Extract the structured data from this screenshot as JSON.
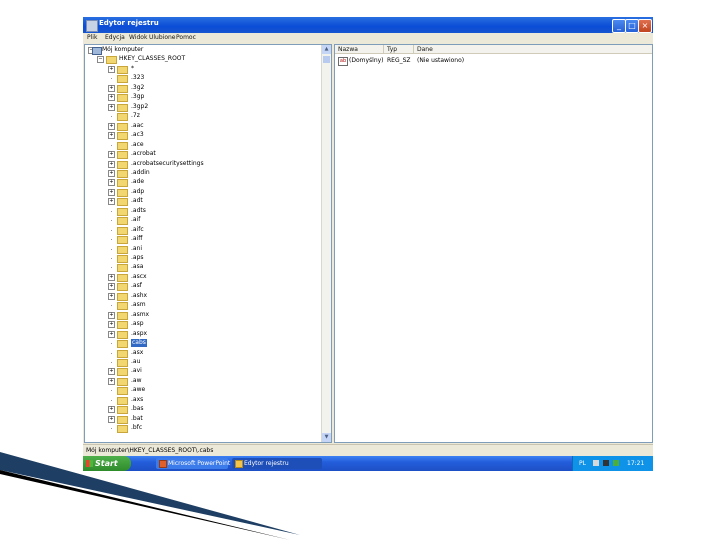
{
  "window": {
    "title": "Edytor rejestru"
  },
  "menu": [
    "Plik",
    "Edycja",
    "Widok",
    "Ulubione",
    "Pomoc"
  ],
  "tree": {
    "root": "Mój komputer",
    "hive": "HKEY_CLASSES_ROOT",
    "items": [
      {
        "label": "*",
        "expandable": true
      },
      {
        "label": ".323",
        "expandable": false
      },
      {
        "label": ".3g2",
        "expandable": true
      },
      {
        "label": ".3gp",
        "expandable": true
      },
      {
        "label": ".3gp2",
        "expandable": true
      },
      {
        "label": ".7z",
        "expandable": false
      },
      {
        "label": ".aac",
        "expandable": true
      },
      {
        "label": ".ac3",
        "expandable": true
      },
      {
        "label": ".ace",
        "expandable": false
      },
      {
        "label": ".acrobat",
        "expandable": true
      },
      {
        "label": ".acrobatsecuritysettings",
        "expandable": true
      },
      {
        "label": ".addin",
        "expandable": true
      },
      {
        "label": ".ade",
        "expandable": true
      },
      {
        "label": ".adp",
        "expandable": true
      },
      {
        "label": ".adt",
        "expandable": true
      },
      {
        "label": ".adts",
        "expandable": false
      },
      {
        "label": ".aif",
        "expandable": false
      },
      {
        "label": ".aifc",
        "expandable": false
      },
      {
        "label": ".aiff",
        "expandable": false
      },
      {
        "label": ".ani",
        "expandable": false
      },
      {
        "label": ".aps",
        "expandable": false
      },
      {
        "label": ".asa",
        "expandable": false
      },
      {
        "label": ".ascx",
        "expandable": true
      },
      {
        "label": ".asf",
        "expandable": true
      },
      {
        "label": ".ashx",
        "expandable": true
      },
      {
        "label": ".asm",
        "expandable": false
      },
      {
        "label": ".asmx",
        "expandable": true
      },
      {
        "label": ".asp",
        "expandable": true
      },
      {
        "label": ".aspx",
        "expandable": true
      },
      {
        "label": ".ass",
        "expandable": false
      },
      {
        "label": ".asx",
        "expandable": false
      },
      {
        "label": ".au",
        "expandable": false
      },
      {
        "label": ".avi",
        "expandable": true
      },
      {
        "label": ".aw",
        "expandable": true
      },
      {
        "label": ".awe",
        "expandable": false
      },
      {
        "label": ".axs",
        "expandable": false
      },
      {
        "label": ".bas",
        "expandable": true
      },
      {
        "label": ".bat",
        "expandable": true
      },
      {
        "label": ".bfc",
        "expandable": false
      }
    ],
    "selected_index": 29,
    "selected_label": "cabs"
  },
  "list": {
    "columns": [
      "Nazwa",
      "Typ",
      "Dane"
    ],
    "rows": [
      {
        "name": "(Domyślny)",
        "type": "REG_SZ",
        "data": "(Nie ustawiono)"
      }
    ]
  },
  "status": "Mój komputer\\HKEY_CLASSES_ROOT\\.cabs",
  "taskbar": {
    "start_label": "Start",
    "tasks": [
      "Microsoft PowerPoint - ...",
      "Edytor rejestru"
    ],
    "tray_time": "17:21"
  },
  "colors": {
    "titlebar": "#0a4cd6",
    "selection": "#316ac5",
    "taskbar": "#245edb",
    "start": "#2e8b2a"
  }
}
